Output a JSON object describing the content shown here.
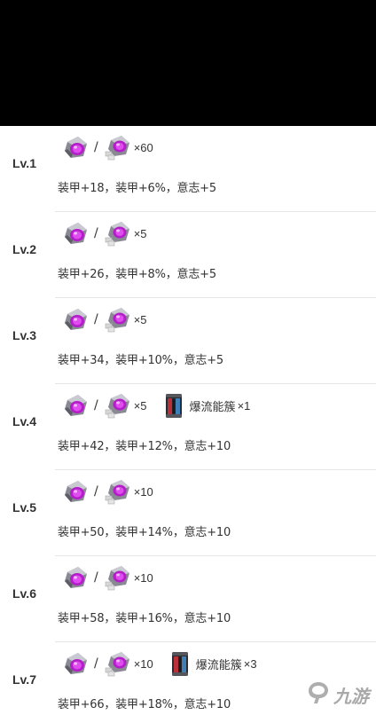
{
  "levels": [
    {
      "label": "Lv.1",
      "qty": "×60",
      "stats": "装甲+18，装甲+6%，意志+5"
    },
    {
      "label": "Lv.2",
      "qty": "×5",
      "stats": "装甲+26，装甲+8%，意志+5"
    },
    {
      "label": "Lv.3",
      "qty": "×5",
      "stats": "装甲+34，装甲+10%，意志+5"
    },
    {
      "label": "Lv.4",
      "qty": "×5",
      "extra_name": "爆流能簇",
      "extra_qty": "×1",
      "stats": "装甲+42，装甲+12%，意志+10"
    },
    {
      "label": "Lv.5",
      "qty": "×10",
      "stats": "装甲+50，装甲+14%，意志+10"
    },
    {
      "label": "Lv.6",
      "qty": "×10",
      "stats": "装甲+58，装甲+16%，意志+10"
    },
    {
      "label": "Lv.7",
      "qty": "×10",
      "extra_name": "爆流能簇",
      "extra_qty": "×3",
      "stats": "装甲+66，装甲+18%，意志+10"
    }
  ],
  "separator": "/",
  "icons": {
    "material_a": "purple-crystal-icon",
    "material_b": "purple-crystal-silver-icon",
    "extra": "energy-canister-icon"
  },
  "watermark": {
    "text": "九游",
    "icon": "jiuyou-logo-icon"
  }
}
